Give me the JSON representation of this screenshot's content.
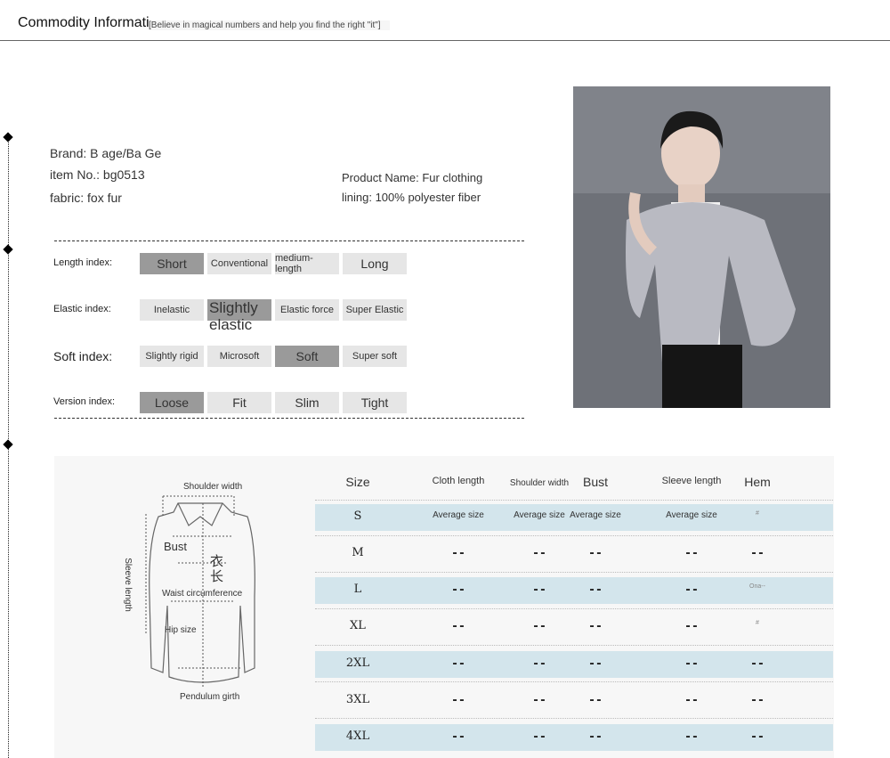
{
  "header": {
    "title": "Commodity Informati",
    "subtitle": "[Believe in magical numbers and help you find the right \"it\"]"
  },
  "product": {
    "brand": "Brand: B age/Ba Ge",
    "item_no": "item No.: bg0513",
    "fabric": "fabric: fox fur",
    "product_name": "Product Name: Fur clothing",
    "lining": "lining: 100% polyester fiber"
  },
  "indices": [
    {
      "label": "Length index:",
      "options": [
        "Short",
        "Conventional",
        "medium-length",
        "Long"
      ],
      "selected": 0
    },
    {
      "label": "Elastic index:",
      "options": [
        "Inelastic",
        "Slightly elastic",
        "Elastic force",
        "Super Elastic"
      ],
      "selected": 1
    },
    {
      "label": "Soft index:",
      "options": [
        "Slightly rigid",
        "Microsoft",
        "Soft",
        "Super soft"
      ],
      "selected": 2
    },
    {
      "label": "Version index:",
      "options": [
        "Loose",
        "Fit",
        "Slim",
        "Tight"
      ],
      "selected": 0
    }
  ],
  "diagram": {
    "shoulder": "Shoulder width",
    "bust": "Bust",
    "length_cn": "衣长",
    "waist": "Waist circumference",
    "sleeve": "Sleeve length",
    "hip": "Hip size",
    "pendulum": "Pendulum girth"
  },
  "size_table": {
    "headers": [
      "Size",
      "Cloth length",
      "Shoulder width",
      "Bust",
      "Sleeve length",
      "Hem"
    ],
    "rows": [
      [
        "S",
        "Average size",
        "Average size",
        "Average size",
        "Average size",
        "#"
      ],
      [
        "M",
        "--",
        "--",
        "--",
        "--",
        "--"
      ],
      [
        "L",
        "--",
        "--",
        "--",
        "--",
        "Ona--"
      ],
      [
        "XL",
        "--",
        "--",
        "--",
        "--",
        "#"
      ],
      [
        "2XL",
        "--",
        "--",
        "--",
        "--",
        "--"
      ],
      [
        "3XL",
        "--",
        "--",
        "--",
        "--",
        "--"
      ],
      [
        "4XL",
        "--",
        "--",
        "--",
        "--",
        "--"
      ]
    ]
  },
  "colors": {
    "selected": "#9a9a9a",
    "option": "#e6e6e6",
    "band": "#d3e5ec"
  }
}
